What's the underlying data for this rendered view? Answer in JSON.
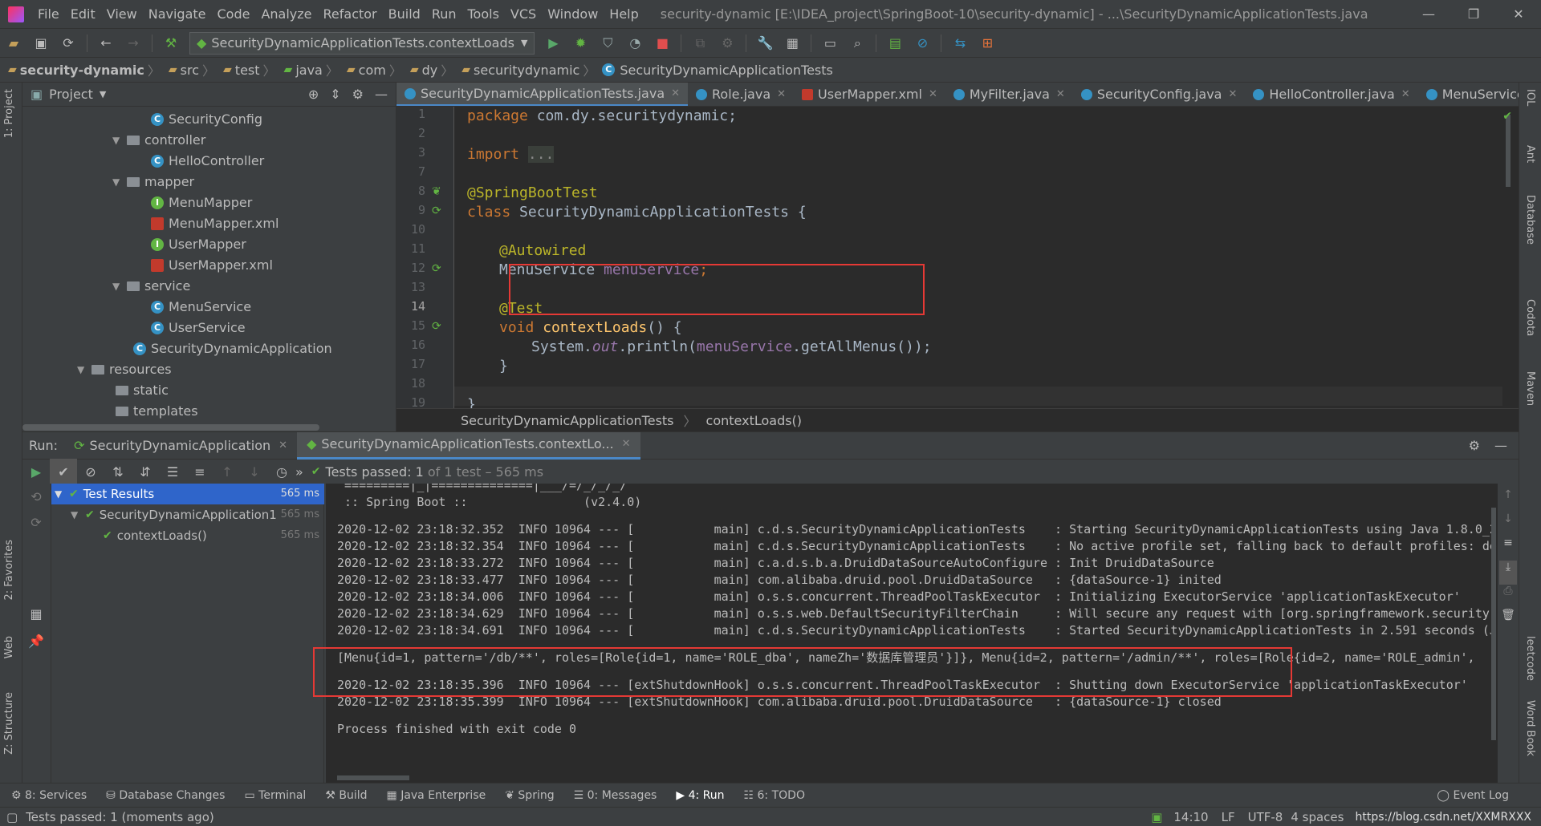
{
  "menu": {
    "items": [
      "File",
      "Edit",
      "View",
      "Navigate",
      "Code",
      "Analyze",
      "Refactor",
      "Build",
      "Run",
      "Tools",
      "VCS",
      "Window",
      "Help"
    ],
    "title": "security-dynamic [E:\\IDEA_project\\SpringBoot-10\\security-dynamic] - ...\\SecurityDynamicApplicationTests.java"
  },
  "toolbar": {
    "run_config": "SecurityDynamicApplicationTests.contextLoads"
  },
  "nav": {
    "crumbs": [
      "security-dynamic",
      "src",
      "test",
      "java",
      "com",
      "dy",
      "securitydynamic",
      "SecurityDynamicApplicationTests"
    ]
  },
  "project": {
    "header": "Project",
    "nodes": [
      {
        "label": "SecurityConfig",
        "kind": "c"
      },
      {
        "label": "controller",
        "kind": "folder"
      },
      {
        "label": "HelloController",
        "kind": "c"
      },
      {
        "label": "mapper",
        "kind": "folder"
      },
      {
        "label": "MenuMapper",
        "kind": "i"
      },
      {
        "label": "MenuMapper.xml",
        "kind": "x"
      },
      {
        "label": "UserMapper",
        "kind": "i"
      },
      {
        "label": "UserMapper.xml",
        "kind": "x"
      },
      {
        "label": "service",
        "kind": "folder"
      },
      {
        "label": "MenuService",
        "kind": "c"
      },
      {
        "label": "UserService",
        "kind": "c"
      },
      {
        "label": "SecurityDynamicApplication",
        "kind": "c"
      },
      {
        "label": "resources",
        "kind": "folder"
      },
      {
        "label": "static",
        "kind": "folder"
      },
      {
        "label": "templates",
        "kind": "folder"
      }
    ]
  },
  "editor": {
    "tabs": [
      "SecurityDynamicApplicationTests.java",
      "Role.java",
      "UserMapper.xml",
      "MyFilter.java",
      "SecurityConfig.java",
      "HelloController.java",
      "MenuService.ja"
    ],
    "line_numbers": [
      "1",
      "2",
      "3",
      "7",
      "8",
      "9",
      "10",
      "11",
      "12",
      "13",
      "14",
      "15",
      "16",
      "17",
      "18",
      "19"
    ],
    "code": {
      "l1a": "package ",
      "l1b": "com.dy.securitydynamic;",
      "l3a": "import ",
      "l3b": "...",
      "l8": "@SpringBootTest",
      "l9a": "class ",
      "l9b": "SecurityDynamicApplicationTests {",
      "l11": "@Autowired",
      "l12a": "MenuService ",
      "l12b": "menuService",
      "l12c": ";",
      "l14": "@Test",
      "l15a": "void ",
      "l15b": "contextLoads",
      "l15c": "() {",
      "l16a": "System.",
      "l16b": "out",
      "l16c": ".println(",
      "l16d": "menuService",
      "l16e": ".getAllMenus());",
      "l17": "}",
      "l19": "}"
    },
    "breadcrumb": [
      "SecurityDynamicApplicationTests",
      "contextLoads()"
    ]
  },
  "run": {
    "label": "Run:",
    "tabs": [
      "SecurityDynamicApplication",
      "SecurityDynamicApplicationTests.contextLo..."
    ],
    "status_pass": "Tests passed: ",
    "status_count": "1",
    "status_rest": " of 1 test – 565 ms",
    "tree": [
      {
        "label": "Test Results",
        "ms": "565 ms"
      },
      {
        "label": "SecurityDynamicApplication1",
        "ms": "565 ms"
      },
      {
        "label": "contextLoads()",
        "ms": "565 ms"
      }
    ],
    "console": [
      " =========|_|==============|___/=/_/_/_/",
      " :: Spring Boot ::                (v2.4.0)",
      "",
      "2020-12-02 23:18:32.352  INFO 10964 --- [           main] c.d.s.SecurityDynamicApplicationTests    : Starting SecurityDynamicApplicationTests using Java 1.8.0_2",
      "2020-12-02 23:18:32.354  INFO 10964 --- [           main] c.d.s.SecurityDynamicApplicationTests    : No active profile set, falling back to default profiles: de",
      "2020-12-02 23:18:33.272  INFO 10964 --- [           main] c.a.d.s.b.a.DruidDataSourceAutoConfigure : Init DruidDataSource",
      "2020-12-02 23:18:33.477  INFO 10964 --- [           main] com.alibaba.druid.pool.DruidDataSource   : {dataSource-1} inited",
      "2020-12-02 23:18:34.006  INFO 10964 --- [           main] o.s.s.concurrent.ThreadPoolTaskExecutor  : Initializing ExecutorService 'applicationTaskExecutor'",
      "2020-12-02 23:18:34.629  INFO 10964 --- [           main] o.s.s.web.DefaultSecurityFilterChain     : Will secure any request with [org.springframework.security.",
      "2020-12-02 23:18:34.691  INFO 10964 --- [           main] c.d.s.SecurityDynamicApplicationTests    : Started SecurityDynamicApplicationTests in 2.591 seconds (J",
      "",
      "[Menu{id=1, pattern='/db/**', roles=[Role{id=1, name='ROLE_dba', nameZh='数据库管理员'}]}, Menu{id=2, pattern='/admin/**', roles=[Role{id=2, name='ROLE_admin',",
      "",
      "2020-12-02 23:18:35.396  INFO 10964 --- [extShutdownHook] o.s.s.concurrent.ThreadPoolTaskExecutor  : Shutting down ExecutorService 'applicationTaskExecutor'",
      "2020-12-02 23:18:35.399  INFO 10964 --- [extShutdownHook] com.alibaba.druid.pool.DruidDataSource   : {dataSource-1} closed",
      "",
      "Process finished with exit code 0"
    ]
  },
  "toolwindows": [
    "8: Services",
    "Database Changes",
    "Terminal",
    "Build",
    "Java Enterprise",
    "Spring",
    "0: Messages",
    "4: Run",
    "6: TODO",
    "Event Log"
  ],
  "status": {
    "message": "Tests passed: 1 (moments ago)",
    "pos": "14:10",
    "lf": "LF",
    "enc": "UTF-8",
    "indent": "4 spaces",
    "watermark": "https://blog.csdn.net/XXMRXXX"
  },
  "left_strip": [
    "1: Project",
    "2: Favorites",
    "Web",
    "Z: Structure"
  ],
  "right_strip": [
    "IOL",
    "Ant",
    "Database",
    "Codota",
    "Maven",
    "leetcode",
    "Word Book"
  ],
  "colors": {
    "accent": "#4a88c7",
    "pass": "#62b543",
    "highlight": "#e53935"
  }
}
